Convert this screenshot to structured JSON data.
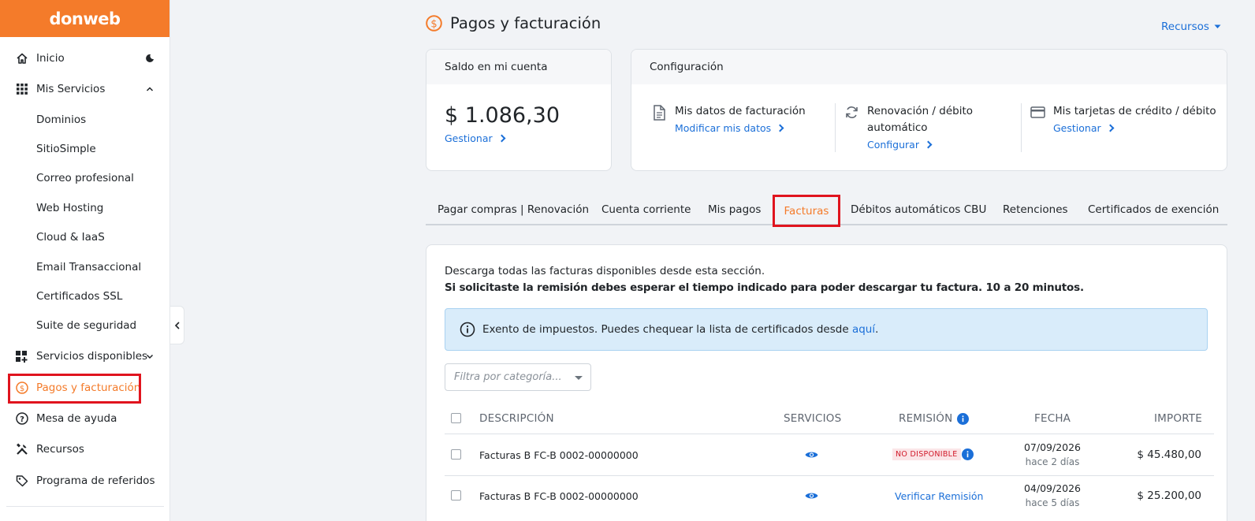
{
  "sidebar": {
    "logo": "donweb",
    "items": {
      "inicio": "Inicio",
      "mis_servicios": "Mis Servicios",
      "servicios_disponibles": "Servicios disponibles",
      "pagos": "Pagos y facturación",
      "mesa": "Mesa de ayuda",
      "recursos": "Recursos",
      "referidos": "Programa de referidos"
    },
    "sub_items": [
      "Dominios",
      "SitioSimple",
      "Correo profesional",
      "Web Hosting",
      "Cloud & IaaS",
      "Email Transaccional",
      "Certificados SSL",
      "Suite de seguridad"
    ]
  },
  "header": {
    "title": "Pagos y facturación",
    "recursos": "Recursos"
  },
  "balance": {
    "header": "Saldo en mi cuenta",
    "amount": "$ 1.086,30",
    "link": "Gestionar"
  },
  "config": {
    "header": "Configuración",
    "billing_title": "Mis datos de facturación",
    "billing_link": "Modificar mis datos",
    "renewal_title_1": "Renovación / débito",
    "renewal_title_2": "automático",
    "renewal_link": "Configurar",
    "cards_title": "Mis tarjetas de crédito / débito",
    "cards_link": "Gestionar"
  },
  "tabs": [
    "Pagar compras | Renovación",
    "Cuenta corriente",
    "Mis pagos",
    "Facturas",
    "Débitos automáticos CBU",
    "Retenciones",
    "Certificados de exención"
  ],
  "invoices": {
    "desc_1": "Descarga todas las facturas disponibles desde esta sección.",
    "desc_2": "Si solicitaste la remisión debes esperar el tiempo indicado para poder descargar tu factura. 10 a 20 minutos.",
    "info_text": "Exento de impuestos. Puedes chequear la lista de certificados desde",
    "info_link": "aquí",
    "info_end": ".",
    "filter_placeholder": "Filtra por categoría...",
    "columns": {
      "descripcion": "DESCRIPCIÓN",
      "servicios": "SERVICIOS",
      "remision": "REMISIÓN",
      "fecha": "FECHA",
      "importe": "IMPORTE"
    },
    "rows": [
      {
        "descripcion": "Facturas B FC-B 0002-00000000",
        "remision": "NO DISPONIBLE",
        "fecha": "07/09/2026",
        "hace": "hace 2 días",
        "importe": "$ 45.480,00"
      },
      {
        "descripcion": "Facturas B FC-B 0002-00000000",
        "remision": "Verificar Remisión",
        "fecha": "04/09/2026",
        "hace": "hace 5 días",
        "importe": "$ 25.200,00"
      }
    ]
  },
  "colors": {
    "brand": "#f47b2a",
    "link": "#1b6fd8",
    "highlight": "#e0141e"
  }
}
